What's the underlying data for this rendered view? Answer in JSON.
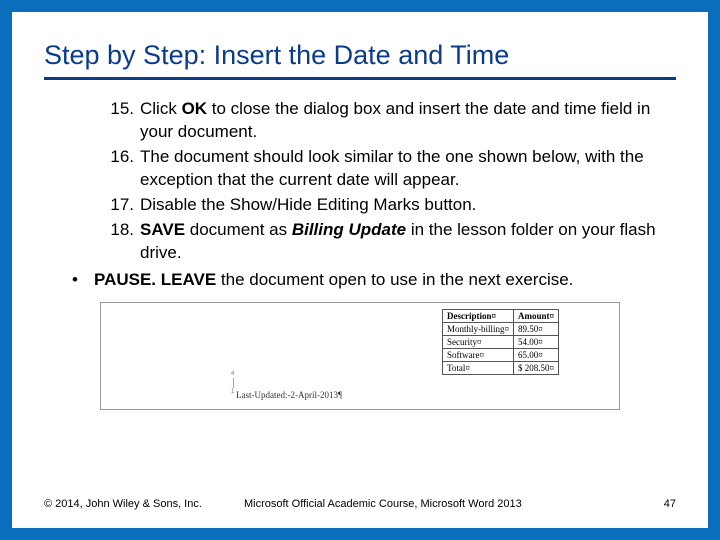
{
  "title": "Step by Step: Insert the Date and Time",
  "steps": [
    {
      "num": "15.",
      "pre": "Click ",
      "bold1": "OK",
      "post": " to close the dialog box and insert the date and time field in your document."
    },
    {
      "num": "16.",
      "pre": "The document should look similar to the one shown below, with the exception that the current date will appear.",
      "bold1": "",
      "post": ""
    },
    {
      "num": "17.",
      "pre": "Disable the Show/Hide Editing Marks button.",
      "bold1": "",
      "post": ""
    },
    {
      "num": "18.",
      "pre": " ",
      "bold1": "SAVE",
      "mid": " document as ",
      "ital": "Billing Update",
      "post": " in the lesson folder on your flash drive."
    }
  ],
  "pause": {
    "bullet": "•",
    "bold1": "PAUSE. LEAVE",
    "rest": " the document open to use in the next exercise."
  },
  "figure": {
    "headers": [
      "Description¤",
      "Amount¤"
    ],
    "rows": [
      [
        "Monthly-billing¤",
        "89.50¤"
      ],
      [
        "Security¤",
        "54.00¤"
      ],
      [
        "Software¤",
        "65.00¤"
      ],
      [
        "Total¤",
        "$ 208.50¤"
      ]
    ],
    "updated": "Last-Updated:-2-April-2013¶",
    "rulerTop": "4",
    "rulerBot": "1"
  },
  "footer": {
    "copyright": "© 2014, John Wiley & Sons, Inc.",
    "course": "Microsoft Official Academic Course, Microsoft Word 2013",
    "page": "47"
  }
}
